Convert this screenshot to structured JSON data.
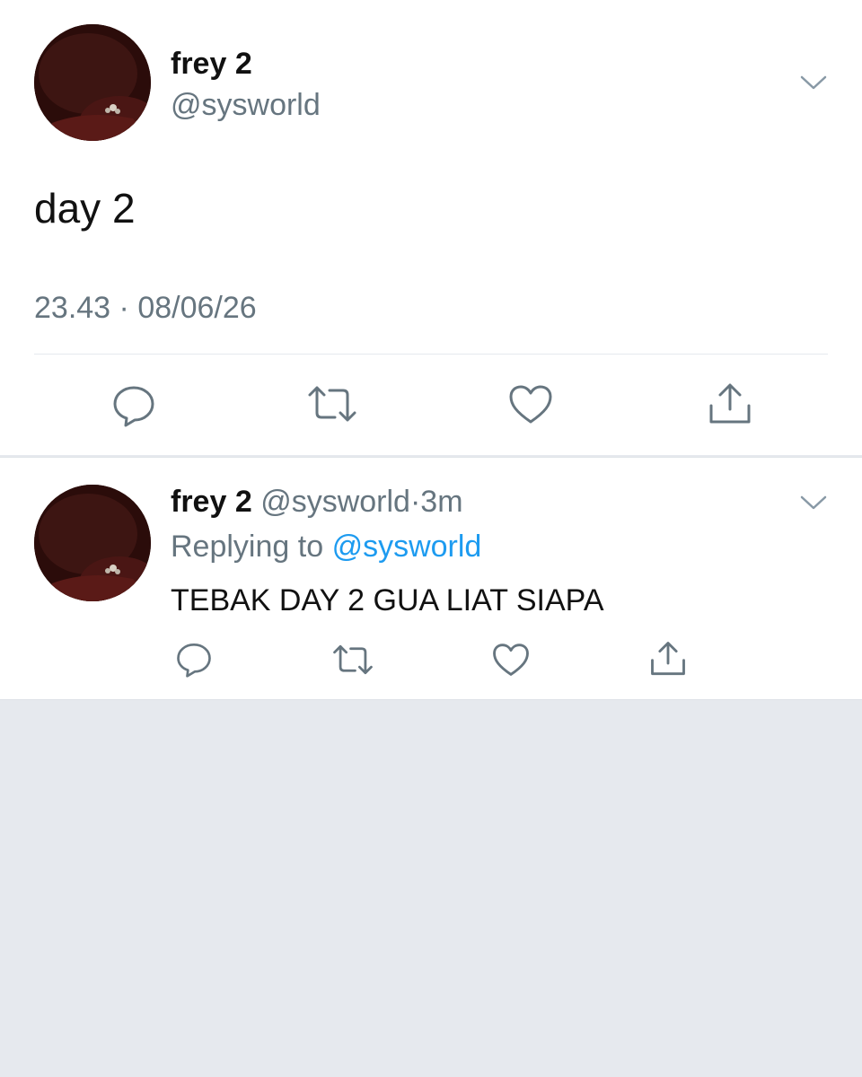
{
  "main_tweet": {
    "author_name": "frey 2",
    "handle": "@sysworld",
    "text": "day 2",
    "time": "23.43",
    "separator": "·",
    "date": "08/06/26",
    "actions": [
      "reply-icon",
      "retweet-icon",
      "like-icon",
      "share-icon"
    ]
  },
  "reply": {
    "author_name": "frey 2",
    "handle": "@sysworld",
    "dot": "·",
    "age": "3m",
    "replying_prefix": "Replying to",
    "replying_handle": "@sysworld",
    "text": "TEBAK DAY 2 GUA LIAT SIAPA",
    "actions": [
      "reply-icon",
      "retweet-icon",
      "like-icon",
      "share-icon"
    ]
  },
  "colors": {
    "text": "#111111",
    "muted": "#66757f",
    "link": "#1d9bf0",
    "background": "#e6e9ee",
    "card": "#ffffff"
  }
}
